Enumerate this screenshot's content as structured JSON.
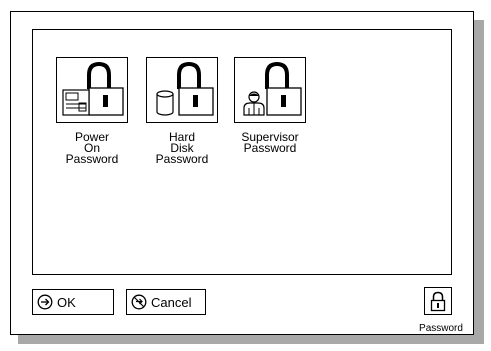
{
  "passwords": [
    {
      "label": "Power\nOn\nPassword",
      "icon": "power-on-lock-icon"
    },
    {
      "label": "Hard\nDisk\nPassword",
      "icon": "hard-disk-lock-icon"
    },
    {
      "label": "Supervisor\nPassword",
      "icon": "supervisor-lock-icon"
    }
  ],
  "buttons": {
    "ok_label": "OK",
    "cancel_label": "Cancel",
    "password_label": "Password"
  }
}
